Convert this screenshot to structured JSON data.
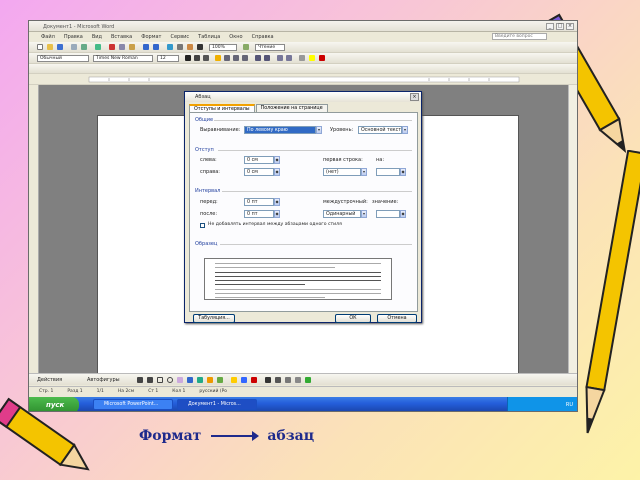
{
  "window": {
    "title": "Документ1 - Microsoft Word",
    "help_placeholder": "Введите вопрос"
  },
  "menu": [
    "Файл",
    "Правка",
    "Вид",
    "Вставка",
    "Формат",
    "Сервис",
    "Таблица",
    "Окно",
    "Справка"
  ],
  "formatting": {
    "style": "Обычный",
    "font": "Times New Roman",
    "size": "12",
    "zoom": "100%",
    "read_label": "Чтение"
  },
  "dialog": {
    "title": "Абзац",
    "tabs": [
      {
        "label": "Отступы и интервалы"
      },
      {
        "label": "Положение на странице"
      }
    ],
    "general": {
      "heading": "Общие",
      "align_label": "Выравнивание:",
      "align_value": "По левому краю",
      "level_label": "Уровень:",
      "level_value": "Основной текст"
    },
    "indent": {
      "heading": "Отступ",
      "left_label": "слева:",
      "left_value": "0 см",
      "right_label": "справа:",
      "right_value": "0 см",
      "first_label": "первая строка:",
      "first_value": "(нет)",
      "by_label": "на:"
    },
    "spacing": {
      "heading": "Интервал",
      "before_label": "перед:",
      "before_value": "0 пт",
      "after_label": "после:",
      "after_value": "0 пт",
      "line_label": "междустрочный:",
      "line_value": "Одинарный",
      "value_label": "значение:"
    },
    "no_space_checkbox": "Не добавлять интервал между абзацами одного стиля",
    "preview_heading": "Образец",
    "buttons": {
      "tabs": "Табуляция...",
      "ok": "ОК",
      "cancel": "Отмена"
    }
  },
  "drawing_bar": {
    "actions": "Действия",
    "autoshapes": "Автофигуры"
  },
  "status": {
    "page": "Стр. 1",
    "section": "Разд 1",
    "pages": "1/1",
    "pos": "На 2см",
    "line": "Ст 1",
    "col": "Кол 1",
    "lang": "русский (Ро"
  },
  "taskbar": {
    "start": "пуск",
    "tasks": [
      {
        "label": "Microsoft PowerPoint..."
      },
      {
        "label": "Документ1 - Micros..."
      }
    ],
    "tray": "RU"
  },
  "caption": {
    "left": "Формат",
    "right": "абзац"
  }
}
